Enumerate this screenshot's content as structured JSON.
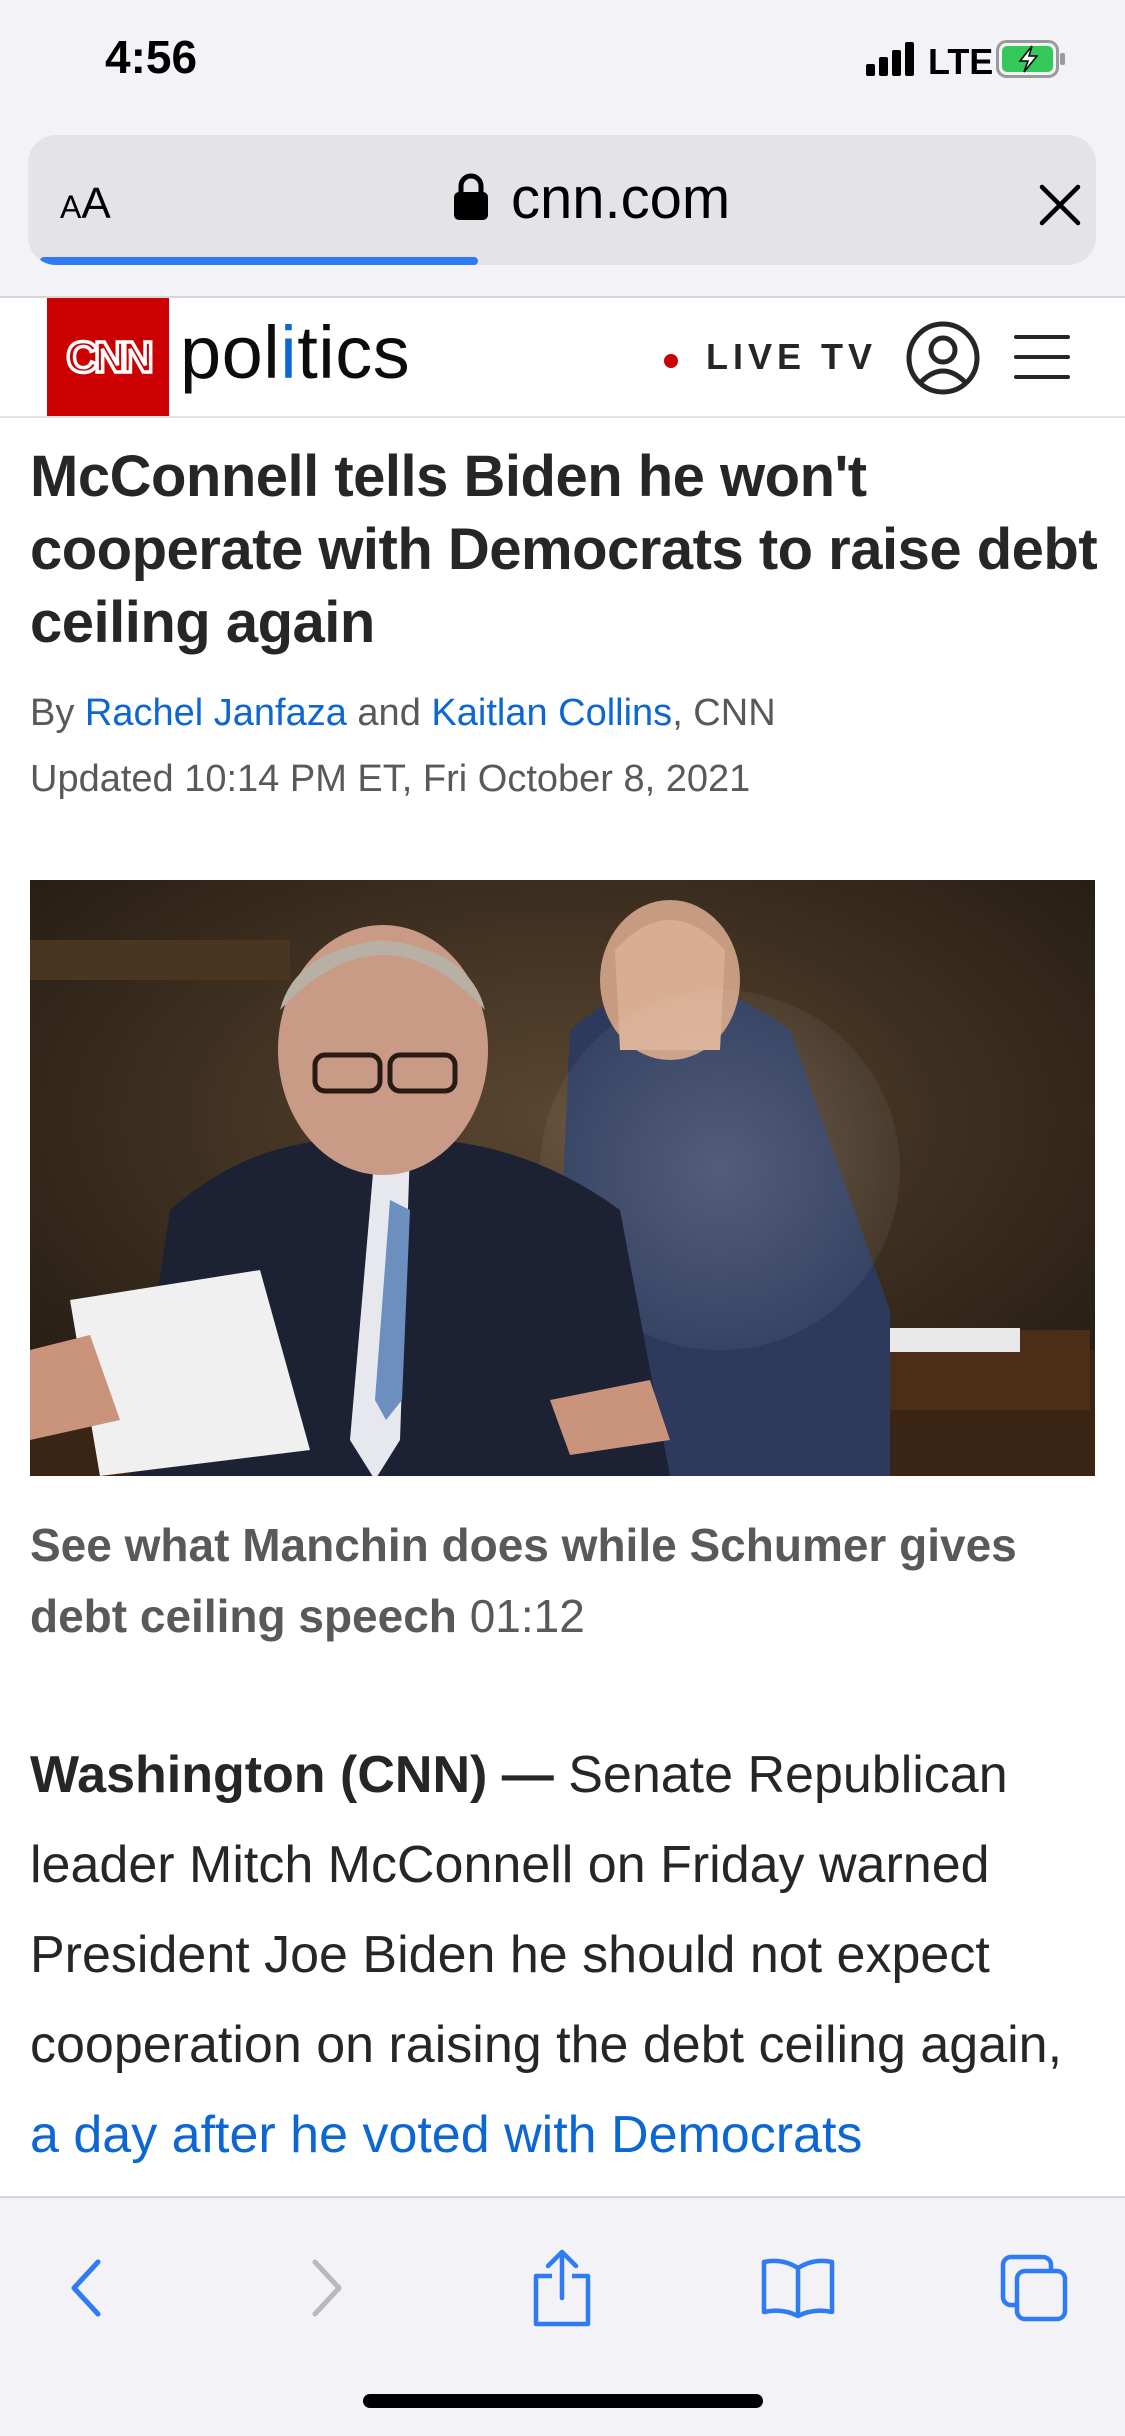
{
  "status_bar": {
    "time": "4:56",
    "network": "LTE",
    "signal_bars": 4,
    "battery_state": "charging"
  },
  "address_bar": {
    "text_size_label_small": "A",
    "text_size_label_big": "A",
    "url": "cnn.com",
    "page_load_progress": 0.42
  },
  "site_header": {
    "logo_text": "CNN",
    "section_prefix": "pol",
    "section_highlight": "i",
    "section_suffix": "tics",
    "live_tv_label": "LIVE TV"
  },
  "article": {
    "headline": "McConnell tells Biden he won't cooperate with Democrats to raise debt ceiling again",
    "byline": {
      "by": "By",
      "author_1": "Rachel Janfaza",
      "and": "and",
      "author_2": "Kaitlan Collins",
      "source": ", CNN"
    },
    "updated": "Updated 10:14 PM ET, Fri October 8, 2021",
    "video": {
      "caption": "See what Manchin does while Schumer gives debt ceiling speech",
      "duration": "01:12"
    },
    "body": {
      "dateline": "Washington (CNN) —",
      "text": " Senate Republican leader Mitch McConnell on Friday warned President Joe Biden he should not expect cooperation on raising the debt ceiling again, ",
      "link_text": "a day after he voted with Democrats"
    }
  },
  "colors": {
    "cnn_red": "#cc0000",
    "link_blue": "#0c66d4",
    "safari_blue": "#2f7bf5",
    "chrome_bg": "#f2f2f7"
  },
  "toolbar_icons": [
    "back-icon",
    "forward-icon",
    "share-icon",
    "bookmarks-icon",
    "tabs-icon"
  ]
}
